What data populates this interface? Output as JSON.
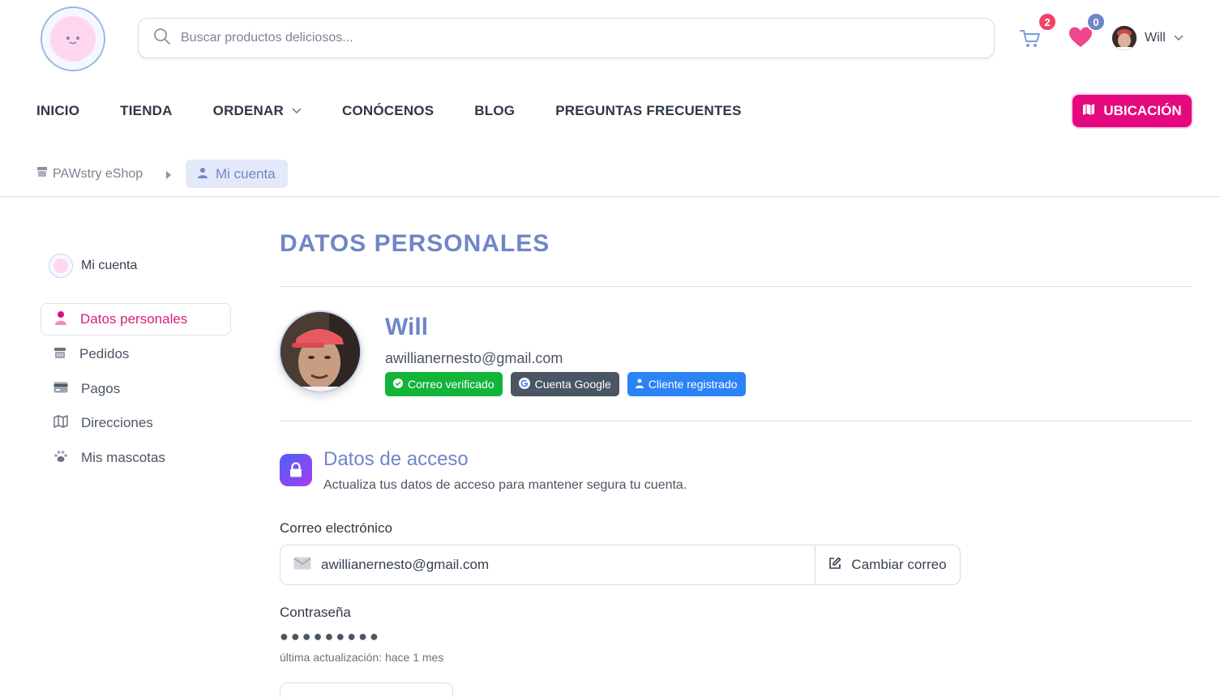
{
  "header": {
    "search_placeholder": "Buscar productos deliciosos...",
    "cart_count": "2",
    "wishlist_count": "0",
    "user_name": "Will"
  },
  "nav": {
    "items": [
      "INICIO",
      "TIENDA",
      "ORDENAR",
      "CONÓCENOS",
      "BLOG",
      "PREGUNTAS FRECUENTES"
    ],
    "location_button": "UBICACIÓN"
  },
  "breadcrumb": {
    "home": "PAWstry eShop",
    "current": "Mi cuenta"
  },
  "sidebar": {
    "heading": "Mi cuenta",
    "items": [
      {
        "label": "Datos personales",
        "icon": "user-icon"
      },
      {
        "label": "Pedidos",
        "icon": "basket-icon"
      },
      {
        "label": "Pagos",
        "icon": "card-icon"
      },
      {
        "label": "Direcciones",
        "icon": "map-icon"
      },
      {
        "label": "Mis mascotas",
        "icon": "paw-icon"
      }
    ]
  },
  "profile": {
    "title": "DATOS PERSONALES",
    "name": "Will",
    "email": "awillianernesto@gmail.com",
    "tags": [
      "Correo verificado",
      "Cuenta Google",
      "Cliente registrado"
    ]
  },
  "access": {
    "title": "Datos de acceso",
    "subtitle": "Actualiza tus datos de acceso para mantener segura tu cuenta.",
    "email_label": "Correo electrónico",
    "email_value": "awillianernesto@gmail.com",
    "change_email": "Cambiar correo",
    "password_label": "Contraseña",
    "password_mask": "●●●●●●●●●",
    "password_updated": "última actualización: hace 1 mes"
  },
  "colors": {
    "brand_blue": "#6f86c7",
    "brand_pink": "#e5097f",
    "verified_green": "#12b53a",
    "google_dark": "#4b5563",
    "registered_blue": "#2b83f6"
  }
}
